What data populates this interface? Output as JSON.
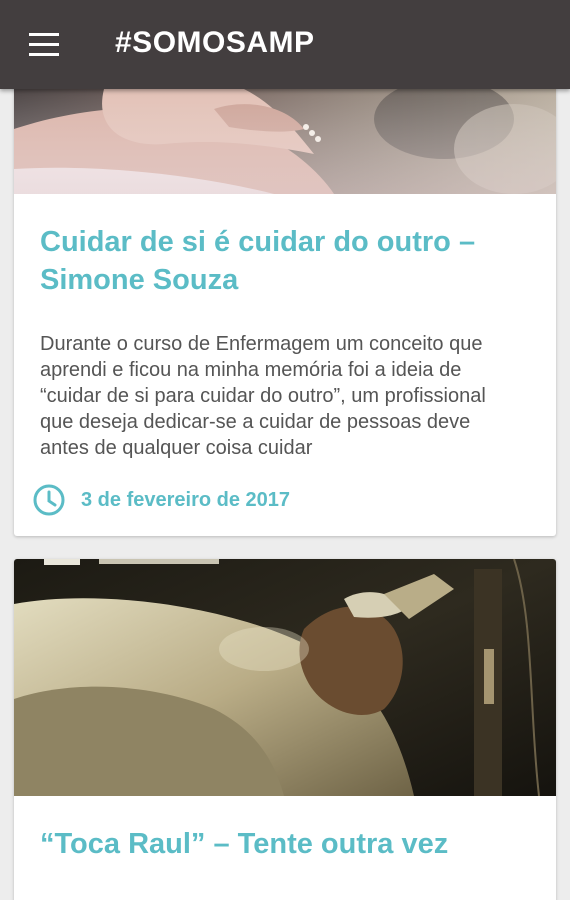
{
  "appbar": {
    "title": "#SOMOSAMP",
    "menu_icon": "hamburger-menu-icon",
    "background": "#433e3f"
  },
  "feed": {
    "accent_color": "#5bbcc6",
    "posts": [
      {
        "title": "Cuidar de si é cuidar do outro – Simone Souza",
        "excerpt": "Durante o curso de Enfermagem um conceito que aprendi e ficou na minha memória foi a ideia de “cuidar de si para cuidar do outro”, um profissional que deseja dedicar-se a cuidar de pessoas deve antes de qualquer coisa cuidar",
        "date": "3 de fevereiro de 2017",
        "date_icon": "clock-icon"
      },
      {
        "title": "“Toca Raul” – Tente outra vez"
      }
    ]
  }
}
